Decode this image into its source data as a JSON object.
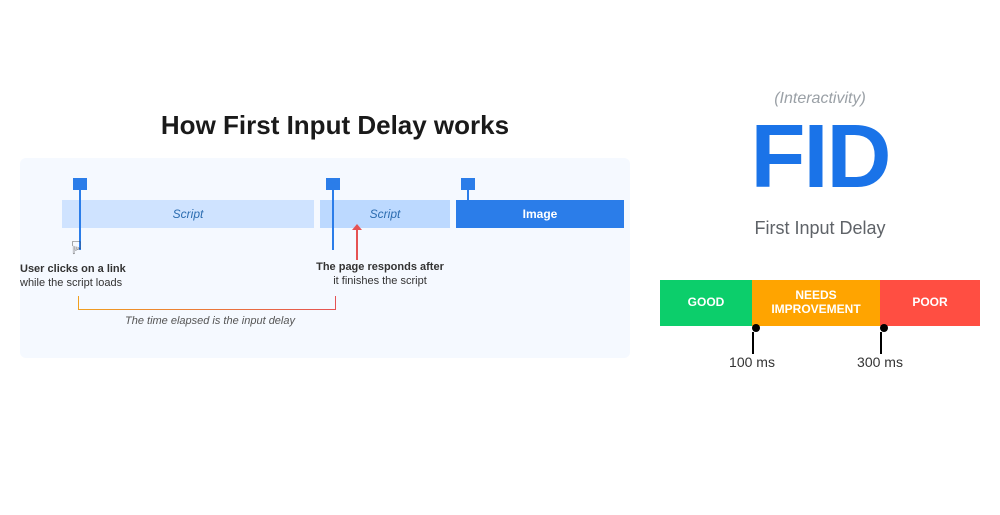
{
  "left": {
    "title": "How First Input Delay works",
    "segments": {
      "script1": "Script",
      "script2": "Script",
      "image": "Image"
    },
    "captions": {
      "click_title": "User clicks on a link",
      "click_sub": "while the script loads",
      "respond_title": "The page responds after",
      "respond_sub": "it finishes the script",
      "elapsed": "The time elapsed is the input delay"
    }
  },
  "right": {
    "subtitle": "(Interactivity)",
    "acronym": "FID",
    "full": "First Input Delay",
    "scale": {
      "good": "GOOD",
      "needs": "NEEDS IMPROVEMENT",
      "poor": "POOR",
      "t1": "100 ms",
      "t2": "300 ms"
    }
  }
}
